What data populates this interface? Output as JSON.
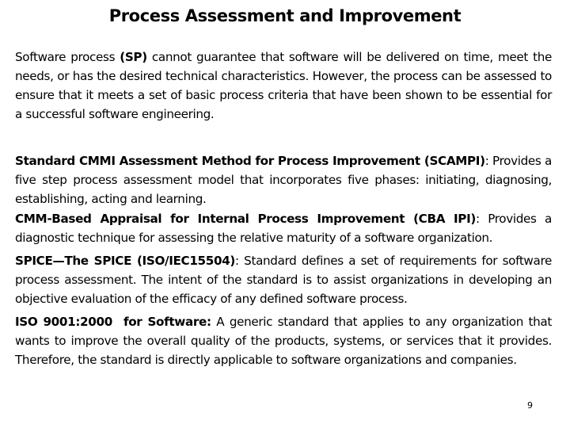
{
  "slide": {
    "title": "Process Assessment and Improvement",
    "intro": {
      "pre": "Software process ",
      "bold": "(SP)",
      "post": " cannot guarantee that software will be delivered on time, meet the needs, or has the desired technical characteristics. However, the process can be assessed to ensure that it meets a set of basic process criteria that have been shown to be essential for a successful software engineering."
    },
    "items": [
      {
        "term": "Standard CMMI Assessment Method for Process Improvement (SCAMPI)",
        "description": ": Provides a five step process assessment model that incorporates five phases: initiating, diagnosing, establishing, acting and learning."
      },
      {
        "term": "CMM-Based Appraisal for Internal Process Improvement (CBA IPI)",
        "description": ": Provides a diagnostic technique for assessing the relative maturity of a software organization."
      },
      {
        "term": "SPICE—The SPICE (ISO/IEC15504)",
        "description": ": Standard defines a set of requirements for software process assessment. The intent of the standard is to assist organizations in developing an objective evaluation of the efficacy of any defined software process."
      },
      {
        "term": "ISO 9001:2000  for Software:",
        "description": " A generic standard that applies to any organization that wants to improve the overall quality of the products, systems, or services that it provides. Therefore, the standard is directly applicable to software organizations and companies."
      }
    ],
    "page_number": "9"
  }
}
